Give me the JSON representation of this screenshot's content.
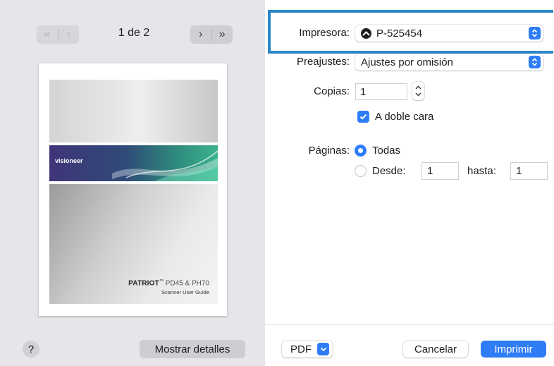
{
  "preview": {
    "page_indicator": "1 de 2",
    "prev_first_icon": "double-chevron-left",
    "prev_icon": "chevron-left",
    "next_icon": "chevron-right",
    "next_last_icon": "double-chevron-right",
    "thumbnail": {
      "brand": "visioneer",
      "product": "PATRIOT",
      "trademark": "™",
      "models": " PD45 & PH70",
      "subtitle": "Scanner User Guide"
    },
    "help_label": "?",
    "details_label": "Mostrar detalles"
  },
  "settings": {
    "printer_label": "Impresora:",
    "printer_value": "P-525454",
    "presets_label": "Preajustes:",
    "presets_value": "Ajustes por omisión",
    "copies_label": "Copias:",
    "copies_value": "1",
    "duplex_label": "A doble cara",
    "duplex_checked": true,
    "pages_label": "Páginas:",
    "pages_all_label": "Todas",
    "pages_all_selected": true,
    "pages_from_label": "Desde:",
    "pages_from_value": "1",
    "pages_to_label": "hasta:",
    "pages_to_value": "1"
  },
  "footer": {
    "pdf_label": "PDF",
    "cancel_label": "Cancelar",
    "print_label": "Imprimir"
  },
  "colors": {
    "accent": "#2f7df6",
    "highlight_box": "#2b86c8",
    "preview_bg": "#e7e4ea"
  }
}
